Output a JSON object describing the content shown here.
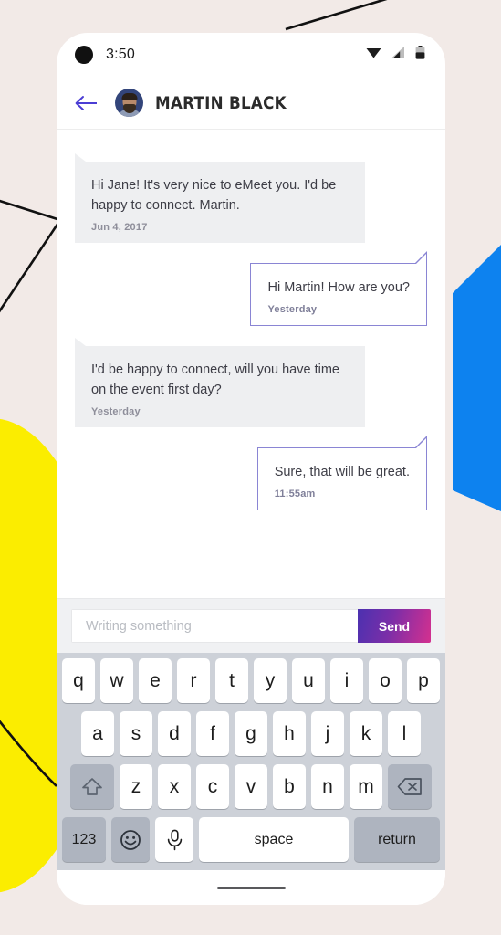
{
  "background": {
    "base_color": "#f2eae7",
    "shapes": [
      {
        "name": "yellow-blob",
        "color": "#fbed00"
      },
      {
        "name": "blue-polygon",
        "color": "#0d82ef"
      },
      {
        "name": "black-line-top-right",
        "color": "#111111"
      },
      {
        "name": "black-line-left-upper",
        "color": "#111111"
      },
      {
        "name": "black-line-left-lower",
        "color": "#111111"
      },
      {
        "name": "black-curve-bottom-left",
        "color": "#111111"
      }
    ]
  },
  "status_bar": {
    "time": "3:50",
    "icons": [
      "wifi-icon",
      "cellular-signal-icon",
      "battery-icon"
    ]
  },
  "header": {
    "back_icon": "arrow-left-icon",
    "back_color": "#4b3dd4",
    "avatar_name": "avatar",
    "title": "MARTIN BLACK"
  },
  "messages": [
    {
      "side": "them",
      "text": "Hi Jane! It's very nice to eMeet you. I'd be happy to connect. Martin.",
      "time": "Jun 4, 2017"
    },
    {
      "side": "me",
      "text": "Hi Martin! How are you?",
      "time": "Yesterday"
    },
    {
      "side": "them",
      "text": "I'd be happy to connect, will you have time on the event first day?",
      "time": "Yesterday"
    },
    {
      "side": "me",
      "text": "Sure, that will be great.",
      "time": "11:55am"
    }
  ],
  "composer": {
    "input_value": "",
    "input_placeholder": "Writing something",
    "send_label": "Send",
    "send_gradient_from": "#4b31b0",
    "send_gradient_to": "#d4308f"
  },
  "keyboard": {
    "row1": [
      "q",
      "w",
      "e",
      "r",
      "t",
      "y",
      "u",
      "i",
      "o",
      "p"
    ],
    "row2": [
      "a",
      "s",
      "d",
      "f",
      "g",
      "h",
      "j",
      "k",
      "l"
    ],
    "row3": [
      "z",
      "x",
      "c",
      "v",
      "b",
      "n",
      "m"
    ],
    "shift_icon": "shift-up-arrow-icon",
    "backspace_icon": "backspace-delete-icon",
    "numbers_label": "123",
    "emoji_icon": "smiley-face-icon",
    "mic_icon": "microphone-icon",
    "space_label": "space",
    "return_label": "return"
  }
}
